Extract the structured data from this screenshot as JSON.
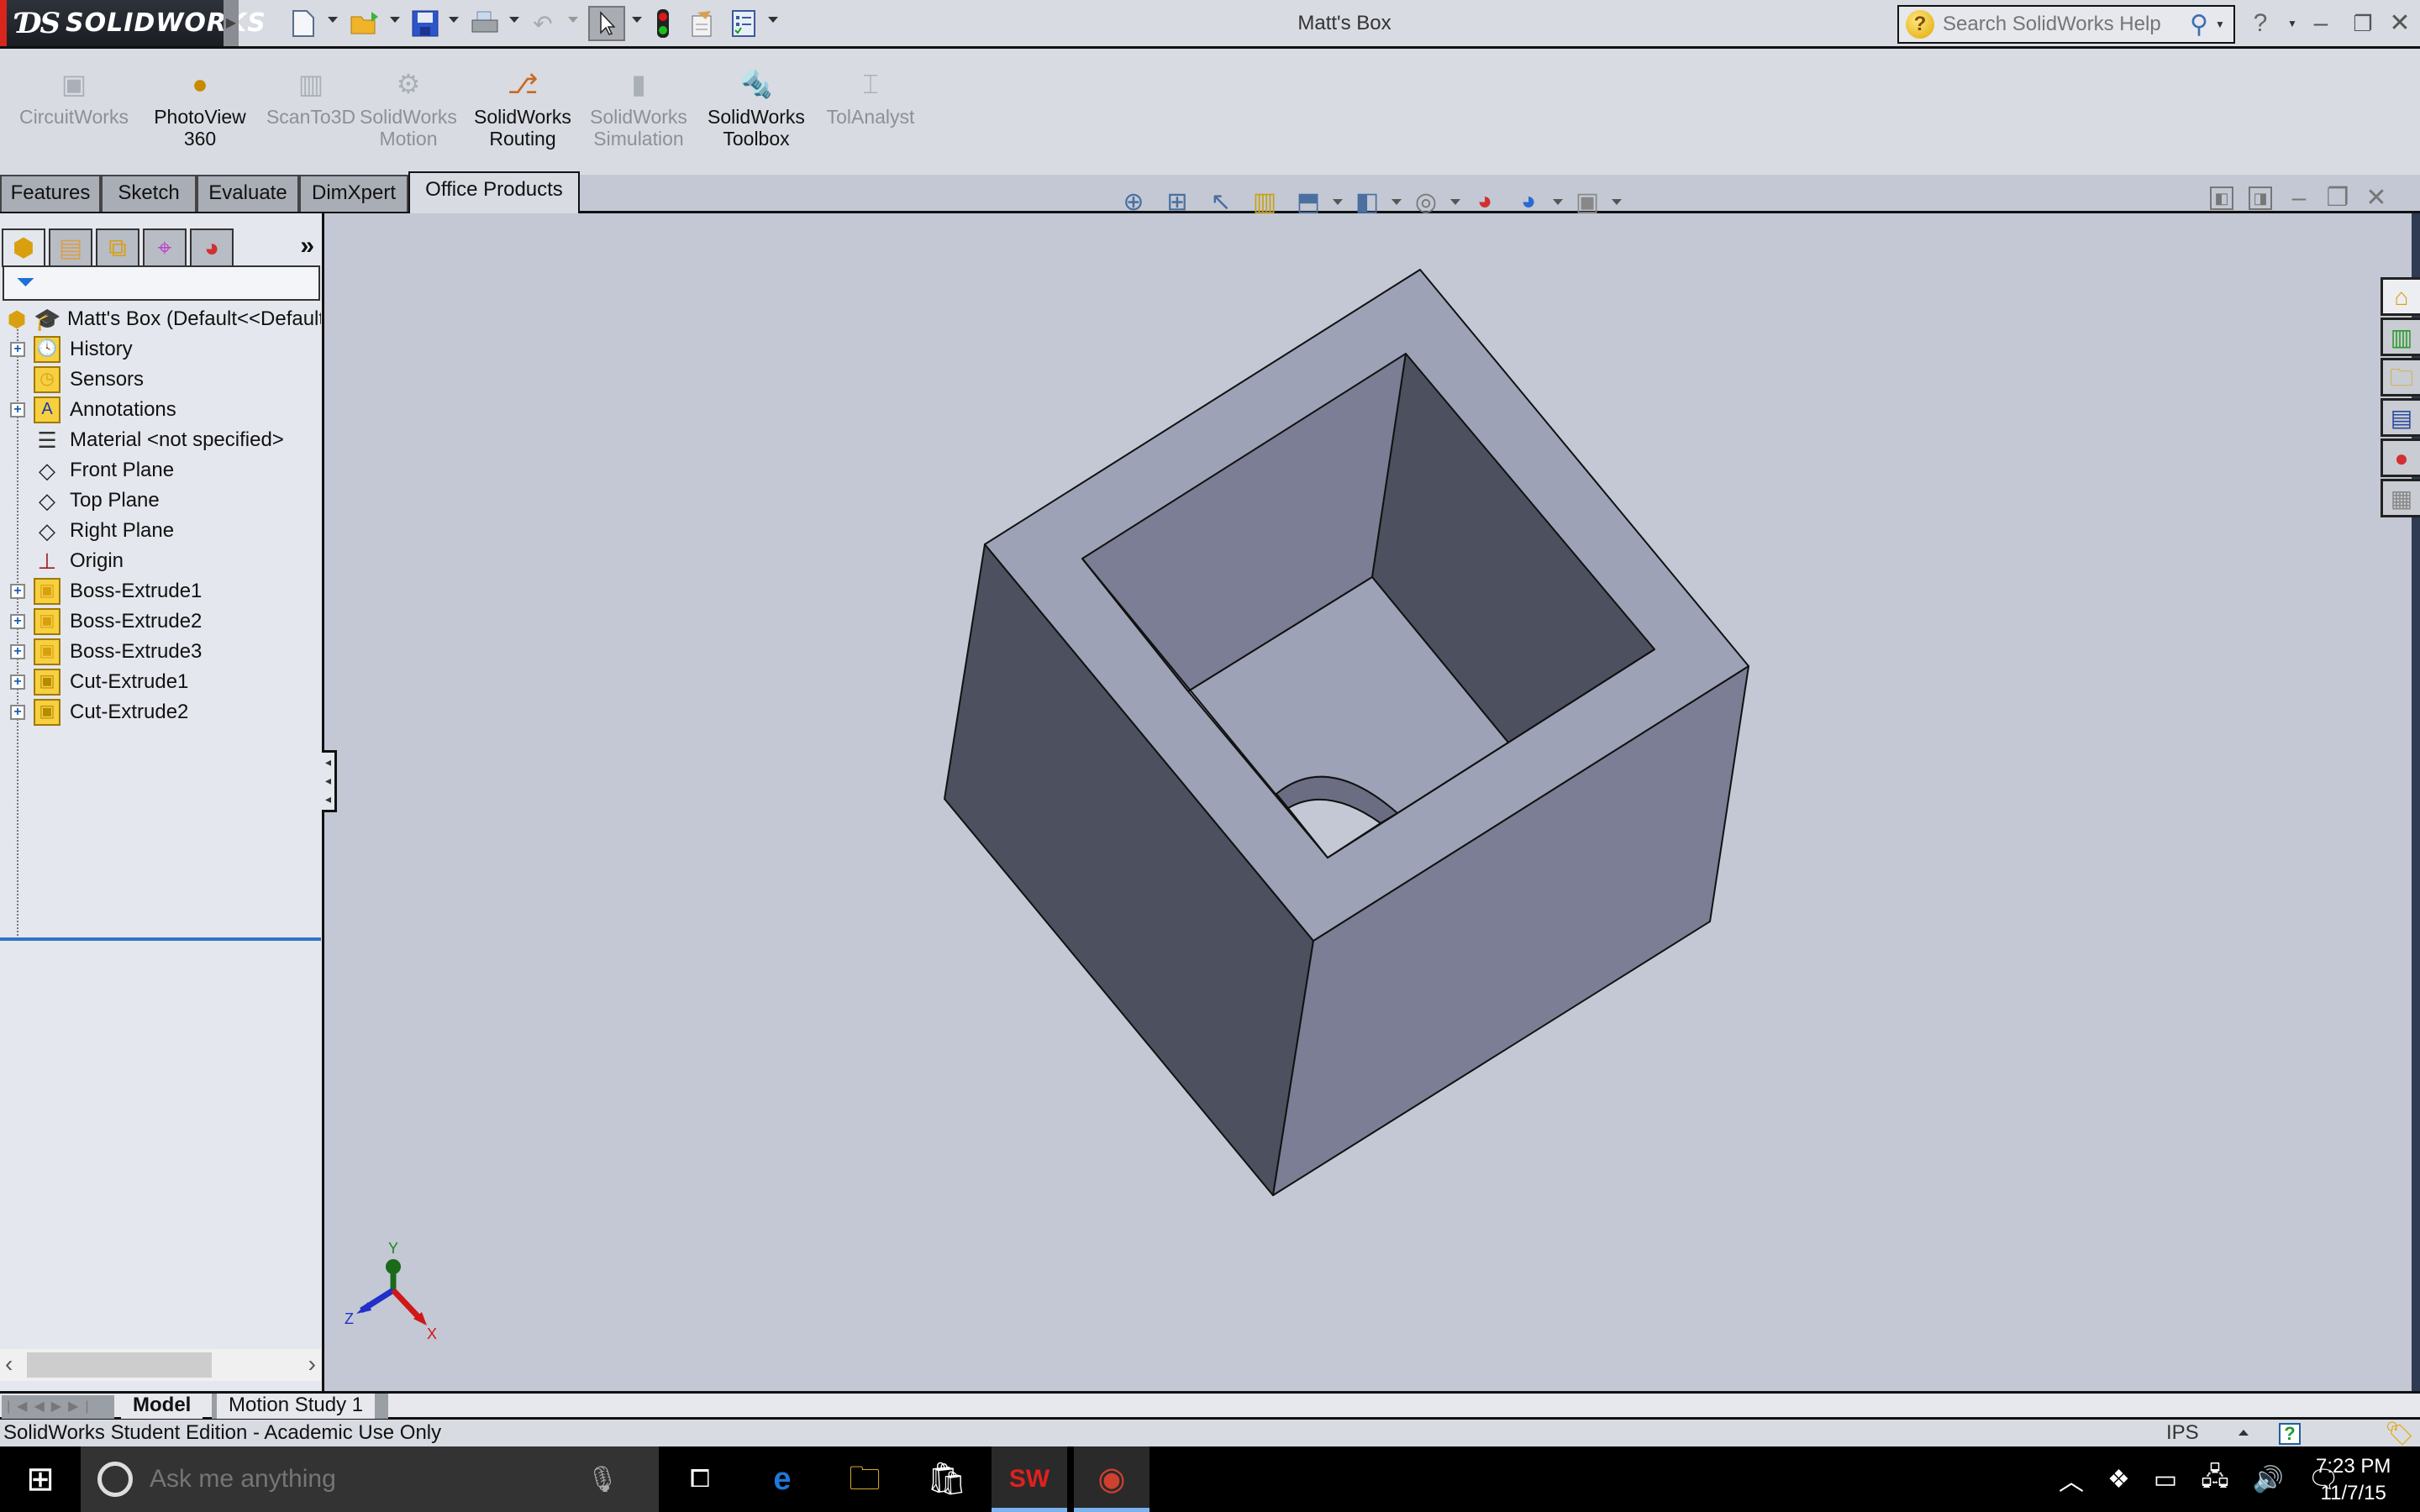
{
  "app": {
    "brand": "SOLIDWORKS",
    "document_title": "Matt's Box",
    "search_placeholder": "Search SolidWorks Help"
  },
  "quick_access": [
    {
      "name": "new-document",
      "icon": "new-file-icon"
    },
    {
      "name": "open",
      "icon": "open-folder-icon"
    },
    {
      "name": "save",
      "icon": "save-icon"
    },
    {
      "name": "print",
      "icon": "print-icon"
    },
    {
      "name": "undo",
      "icon": "undo-icon"
    },
    {
      "name": "select",
      "icon": "cursor-icon"
    },
    {
      "name": "rebuild",
      "icon": "traffic-light-icon"
    },
    {
      "name": "file-properties",
      "icon": "file-properties-icon"
    },
    {
      "name": "options",
      "icon": "options-icon"
    }
  ],
  "command_manager": [
    {
      "label1": "CircuitWorks",
      "label2": "",
      "enabled": false,
      "icon": "chip-icon"
    },
    {
      "label1": "PhotoView",
      "label2": "360",
      "enabled": true,
      "icon": "photoview-sphere-icon"
    },
    {
      "label1": "ScanTo3D",
      "label2": "",
      "enabled": false,
      "icon": "scan-icon"
    },
    {
      "label1": "SolidWorks",
      "label2": "Motion",
      "enabled": false,
      "icon": "gears-icon"
    },
    {
      "label1": "SolidWorks",
      "label2": "Routing",
      "enabled": true,
      "icon": "routing-icon"
    },
    {
      "label1": "SolidWorks",
      "label2": "Simulation",
      "enabled": false,
      "icon": "cylinder-icon"
    },
    {
      "label1": "SolidWorks",
      "label2": "Toolbox",
      "enabled": true,
      "icon": "bolt-icon"
    },
    {
      "label1": "TolAnalyst",
      "label2": "",
      "enabled": false,
      "icon": "tolerance-icon"
    }
  ],
  "tabs": [
    {
      "label": "Features",
      "active": false
    },
    {
      "label": "Sketch",
      "active": false
    },
    {
      "label": "Evaluate",
      "active": false
    },
    {
      "label": "DimXpert",
      "active": false
    },
    {
      "label": "Office Products",
      "active": true
    }
  ],
  "feature_tree": {
    "root": "Matt's Box  (Default<<Default>",
    "items": [
      {
        "label": "History",
        "icon": "history-folder-icon",
        "expandable": true
      },
      {
        "label": "Sensors",
        "icon": "sensors-folder-icon",
        "expandable": false
      },
      {
        "label": "Annotations",
        "icon": "annotations-folder-icon",
        "expandable": true
      },
      {
        "label": "Material <not specified>",
        "icon": "material-icon",
        "expandable": false
      },
      {
        "label": "Front Plane",
        "icon": "plane-icon",
        "expandable": false
      },
      {
        "label": "Top Plane",
        "icon": "plane-icon",
        "expandable": false
      },
      {
        "label": "Right Plane",
        "icon": "plane-icon",
        "expandable": false
      },
      {
        "label": "Origin",
        "icon": "origin-icon",
        "expandable": false
      },
      {
        "label": "Boss-Extrude1",
        "icon": "boss-extrude-icon",
        "expandable": true
      },
      {
        "label": "Boss-Extrude2",
        "icon": "boss-extrude-icon",
        "expandable": true
      },
      {
        "label": "Boss-Extrude3",
        "icon": "boss-extrude-icon",
        "expandable": true
      },
      {
        "label": "Cut-Extrude1",
        "icon": "cut-extrude-icon",
        "expandable": true
      },
      {
        "label": "Cut-Extrude2",
        "icon": "cut-extrude-icon",
        "expandable": true
      }
    ]
  },
  "triad": {
    "x": "X",
    "y": "Y",
    "z": "Z"
  },
  "bottom_tabs": {
    "model": "Model",
    "motion": "Motion Study 1"
  },
  "status": {
    "text": "SolidWorks Student Edition - Academic Use Only",
    "units": "IPS"
  },
  "taskbar": {
    "search_placeholder": "Ask me anything",
    "time": "7:23 PM",
    "date": "11/7/15"
  },
  "colors": {
    "viewport_bg": "#c3c8d4",
    "face_top": "#9ea2b7",
    "face_left": "#4d505e",
    "face_right": "#7b7e94",
    "brand_red": "#d8261c"
  }
}
